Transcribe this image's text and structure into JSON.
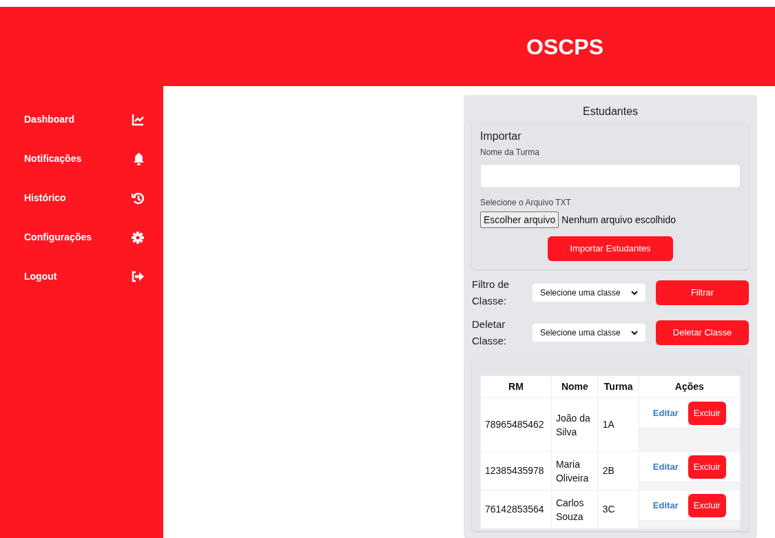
{
  "header": {
    "title": "OSCPS"
  },
  "sidebar": {
    "items": [
      {
        "label": "Dashboard"
      },
      {
        "label": "Notificações"
      },
      {
        "label": "Histórico"
      },
      {
        "label": "Configurações"
      },
      {
        "label": "Logout"
      }
    ]
  },
  "panel": {
    "title": "Estudantes",
    "import": {
      "heading": "Importar",
      "class_name_label": "Nome da Turma",
      "file_label": "Selecione o Arquivo TXT",
      "file_button": "Escolher arquivo",
      "file_status": "Nenhum arquivo escolhido",
      "submit": "Importar Estudantes"
    },
    "filter": {
      "label": "Filtro de Classe:",
      "select_value": "Selecione uma classe",
      "button": "Filtrar"
    },
    "delete": {
      "label": "Deletar Classe:",
      "select_value": "Selecione uma classe",
      "button": "Deletar Classe"
    },
    "table": {
      "columns": [
        "RM",
        "Nome",
        "Turma",
        "Ações"
      ],
      "rows": [
        {
          "rm": "78965485462",
          "nome": "João da Silva",
          "turma": "1A",
          "edit": "Editar",
          "delete": "Excluir"
        },
        {
          "rm": "12385435978",
          "nome": "Maria Oliveira",
          "turma": "2B",
          "edit": "Editar",
          "delete": "Excluir"
        },
        {
          "rm": "76142853564",
          "nome": "Carlos Souza",
          "turma": "3C",
          "edit": "Editar",
          "delete": "Excluir"
        }
      ]
    }
  }
}
